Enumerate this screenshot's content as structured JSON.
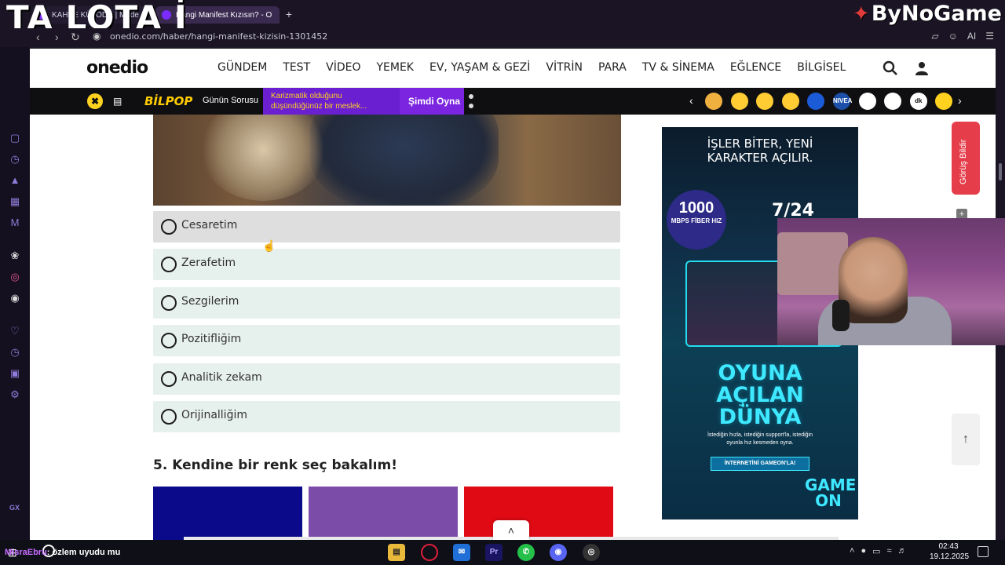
{
  "overlay": {
    "stream_title": "TA LOTA İ",
    "sponsor": "ByNoGame"
  },
  "browser": {
    "tabs": [
      {
        "label": "KAHPE KÜLÖDE | Made"
      },
      {
        "label": "Hangi Manifest Kızısın? - O"
      }
    ],
    "new_tab": "+",
    "url": "onedio.com/haber/hangi-manifest-kizisin-1301452",
    "ai_label": "AI",
    "gx_label": "GX"
  },
  "site": {
    "logo": "onedio",
    "nav": [
      "GÜNDEM",
      "TEST",
      "VİDEO",
      "YEMEK",
      "EV, YAŞAM & GEZİ",
      "VİTRİN",
      "PARA",
      "TV & SİNEMA",
      "EĞLENCE",
      "BİLGİSEL"
    ],
    "promo": {
      "brand": "BİLPOP",
      "daily_question": "Günün Sorusu",
      "question_preview": "Karizmatik olduğunu düşündüğünüz bir meslek...",
      "play": "Şimdi Oyna"
    },
    "carousel_badges": [
      {
        "label": "",
        "color": "#f0b040"
      },
      {
        "label": "",
        "color": "#ffcc33"
      },
      {
        "label": "",
        "color": "#ffcc33"
      },
      {
        "label": "",
        "color": "#ffcc33"
      },
      {
        "label": "",
        "color": "#1c5bd8"
      },
      {
        "label": "NIVEA",
        "color": "#1c4fa8"
      },
      {
        "label": "",
        "color": "#ffffff"
      },
      {
        "label": "",
        "color": "#ffffff"
      },
      {
        "label": "dk",
        "color": "#ffffff"
      },
      {
        "label": "",
        "color": "#ffd21f"
      }
    ]
  },
  "quiz": {
    "options": [
      "Cesaretim",
      "Zerafetim",
      "Sezgilerim",
      "Pozitifliğim",
      "Analitik zekam",
      "Orijinalliğim"
    ],
    "hovered_index": 0,
    "next_question": "5. Kendine bir renk seç bakalım!",
    "color_swatches": [
      "#0a0a8a",
      "#7b4ca8",
      "#e00a14"
    ]
  },
  "ad": {
    "headline": "İŞLER BİTER, YENİ KARAKTER AÇILIR.",
    "speed_number": "1000",
    "speed_unit": "MBPS FİBER HIZ",
    "support": "7/24",
    "big_text": "OYUNA AÇILAN DÜNYA",
    "small_text": "İstediğin hızla, istediğin support'la, istediğin oyunla hız kesmeden oyna.",
    "cta": "İNTERNETİNİ GAMEON'LA!",
    "brand": "GAME ON"
  },
  "feedback_label": "Görüş Bildir",
  "taskbar": {
    "chat_nick": "MisraEbru",
    "chat_message": ": özlem uyudu mu",
    "time": "02:43",
    "date": "19.12.2025"
  }
}
